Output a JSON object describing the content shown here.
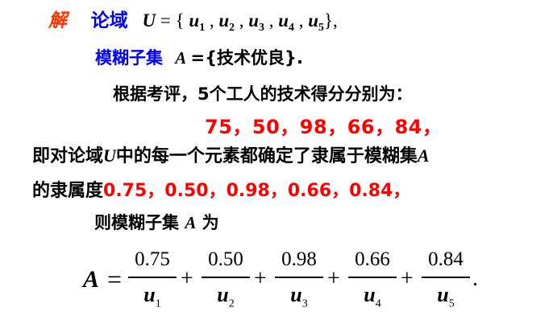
{
  "line1": {
    "jie": "解",
    "lunyu": "论域",
    "U": "U",
    "eq_open": " = {",
    "u": "u",
    "subs": [
      "1",
      "2",
      "3",
      "4",
      "5"
    ],
    "sep": " , ",
    "close": "},"
  },
  "line2": {
    "label": "模糊子集",
    "A": "A",
    "rest": " ={技术优良}."
  },
  "line3": {
    "text": "根据考评，5个工人的技术得分分别为："
  },
  "line4": {
    "scores": "75，50，98，66，84，"
  },
  "line5": {
    "pre": "即对论域",
    "U": "U",
    "mid": "中的每一个元素都确定了隶属于模糊集",
    "A": "A"
  },
  "line6": {
    "pre": "的隶属度",
    "values": "0.75，0.50，0.98，0.66，0.84，"
  },
  "line7": {
    "pre": "则模糊子集  ",
    "A": "A",
    "post": " 为"
  },
  "formula": {
    "lhs": "A",
    "eq": "=",
    "plus": "+",
    "end": ".",
    "terms": [
      {
        "num": "0.75",
        "var": "u",
        "sub": "1"
      },
      {
        "num": "0.50",
        "var": "u",
        "sub": "2"
      },
      {
        "num": "0.98",
        "var": "u",
        "sub": "3"
      },
      {
        "num": "0.66",
        "var": "u",
        "sub": "4"
      },
      {
        "num": "0.84",
        "var": "u",
        "sub": "5"
      }
    ]
  }
}
